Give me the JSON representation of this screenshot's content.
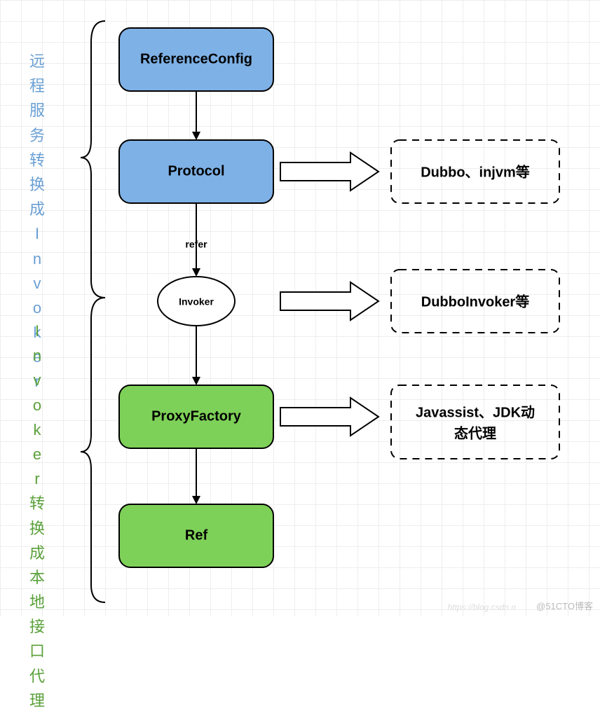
{
  "labels": {
    "left_upper": "远程服务转换成Invoker",
    "left_lower": "Invoker转换成本地接口代理"
  },
  "nodes": {
    "reference_config": "ReferenceConfig",
    "protocol": "Protocol",
    "invoker": "Invoker",
    "proxy_factory": "ProxyFactory",
    "ref": "Ref"
  },
  "edges": {
    "refer": "refer"
  },
  "dashed": {
    "dubbo_injvm": "Dubbo、injvm等",
    "dubbo_invoker": "DubboInvoker等",
    "javassist_jdk_line1": "Javassist、JDK动",
    "javassist_jdk_line2": "态代理"
  },
  "watermark": "@51CTO博客",
  "watermark2": "https://blog.csdn.n"
}
